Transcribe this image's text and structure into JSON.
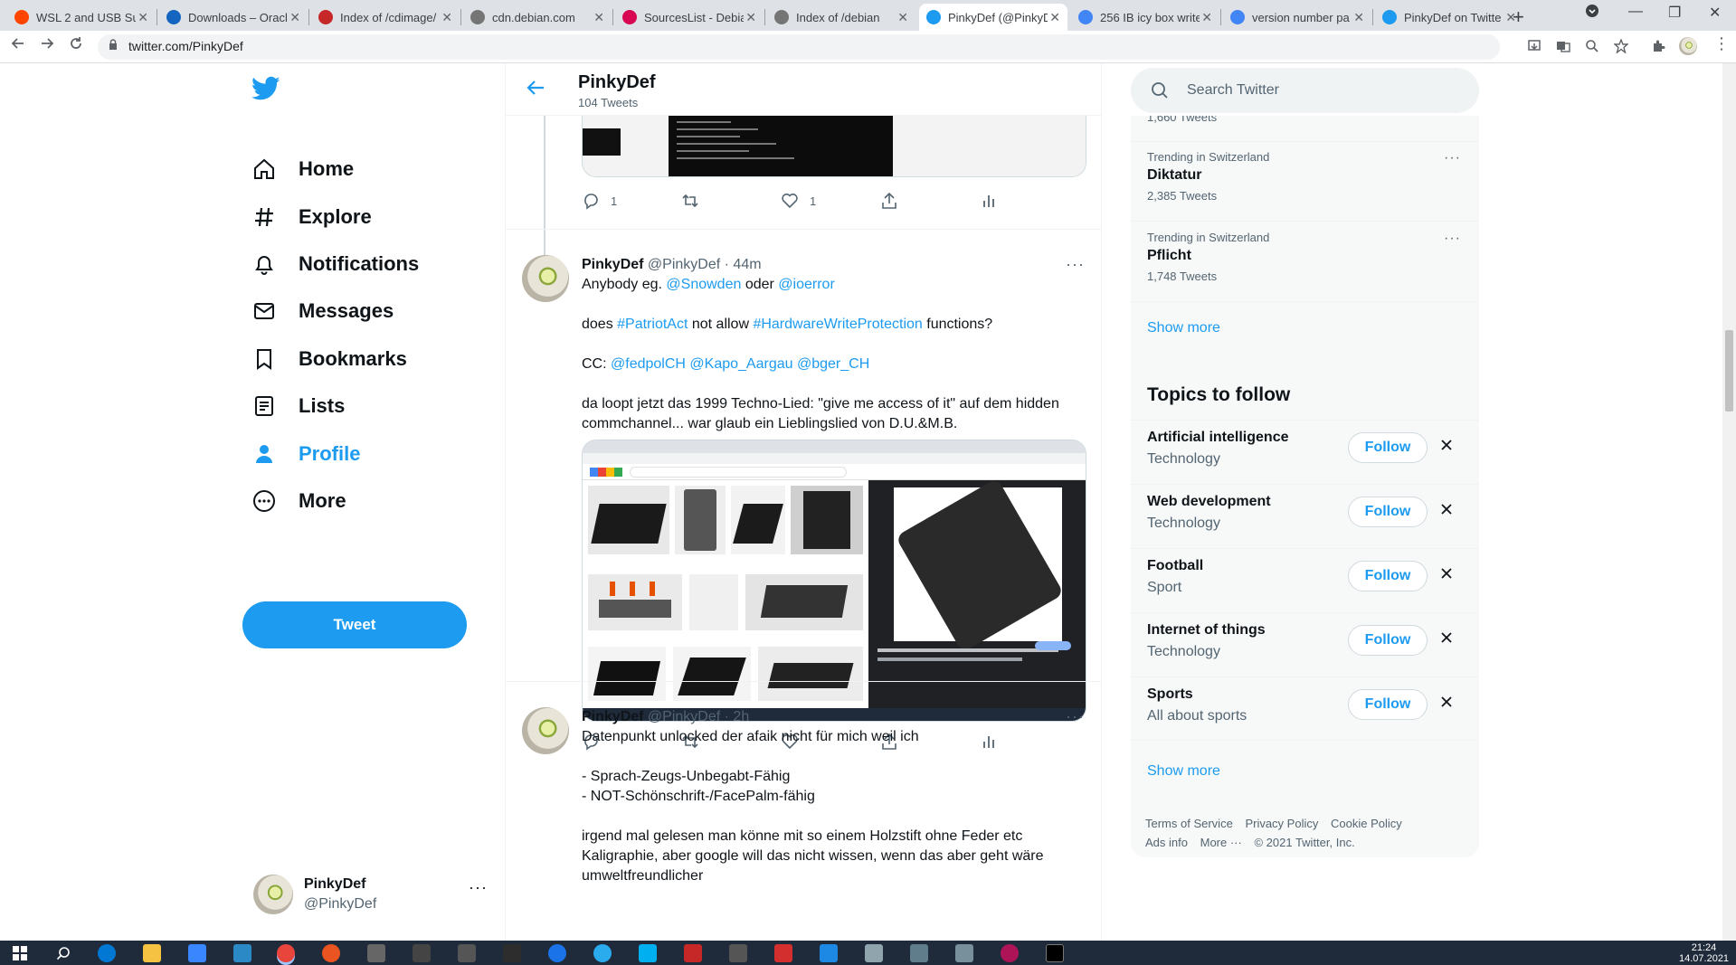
{
  "browser": {
    "tabs": [
      {
        "title": "WSL 2 and USB Sup",
        "fav_color": "#ff4500",
        "active": false
      },
      {
        "title": "Downloads – Oracl",
        "fav_color": "#1565c0",
        "active": false
      },
      {
        "title": "Index of /cdimage/",
        "fav_color": "#c62828",
        "active": false
      },
      {
        "title": "cdn.debian.com",
        "fav_color": "#757575",
        "active": false
      },
      {
        "title": "SourcesList - Debia",
        "fav_color": "#d70751",
        "active": false
      },
      {
        "title": "Index of /debian",
        "fav_color": "#757575",
        "active": false
      },
      {
        "title": "PinkyDef (@PinkyD",
        "fav_color": "#1d9bf0",
        "active": true
      },
      {
        "title": "256 IB icy box write",
        "fav_color": "#4285f4",
        "active": false
      },
      {
        "title": "version number pa",
        "fav_color": "#4285f4",
        "active": false
      },
      {
        "title": "PinkyDef on Twitte",
        "fav_color": "#1d9bf0",
        "active": false
      }
    ],
    "url": "twitter.com/PinkyDef"
  },
  "nav": {
    "items": [
      {
        "label": "Home",
        "icon": "home-icon"
      },
      {
        "label": "Explore",
        "icon": "hashtag-icon"
      },
      {
        "label": "Notifications",
        "icon": "bell-icon"
      },
      {
        "label": "Messages",
        "icon": "envelope-icon"
      },
      {
        "label": "Bookmarks",
        "icon": "bookmark-icon"
      },
      {
        "label": "Lists",
        "icon": "list-icon"
      },
      {
        "label": "Profile",
        "icon": "person-icon"
      },
      {
        "label": "More",
        "icon": "more-circle-icon"
      }
    ],
    "tweet_button": "Tweet",
    "account": {
      "name": "PinkyDef",
      "handle": "@PinkyDef"
    }
  },
  "header": {
    "title": "PinkyDef",
    "subtitle": "104 Tweets"
  },
  "prev_tweet": {
    "replies": "1",
    "likes": "1"
  },
  "tweets": [
    {
      "name": "PinkyDef",
      "handle": "@PinkyDef",
      "time": "· 44m",
      "line1_pre": "Anybody eg. ",
      "line1_m1": "@Snowden",
      "line1_mid": " oder ",
      "line1_m2": "@ioerror",
      "p2_pre": "does ",
      "p2_tag1": "#PatriotAct",
      "p2_mid": " not allow ",
      "p2_tag2": "#HardwareWriteProtection",
      "p2_post": " functions?",
      "p3_pre": "CC: ",
      "p3_m1": "@fedpolCH",
      "p3_m2": "@Kapo_Aargau",
      "p3_m3": "@bger_CH",
      "p4": "da loopt jetzt das 1999 Techno-Lied: \"give me access of it\" auf dem hidden commchannel... war glaub ein Lieblingslied von D.U.&M.B."
    },
    {
      "name": "PinkyDef",
      "handle": "@PinkyDef",
      "time": "· 2h",
      "line1": "Datenpunkt unlocked der afaik nicht für mich weil ich",
      "bullet1": "- Sprach-Zeugs-Unbegabt-Fähig",
      "bullet2": "- NOT-Schönschrift-/FacePalm-fähig",
      "p3": "irgend mal gelesen man könne mit so einem Holzstift ohne Feder etc Kaligraphie, aber google will das nicht wissen, wenn das aber geht wäre umweltfreundlicher"
    }
  ],
  "search": {
    "placeholder": "Search Twitter"
  },
  "trends": {
    "partial_count": "1,660 Tweets",
    "items": [
      {
        "context": "Trending in Switzerland",
        "title": "Diktatur",
        "count": "2,385 Tweets"
      },
      {
        "context": "Trending in Switzerland",
        "title": "Pflicht",
        "count": "1,748 Tweets"
      }
    ],
    "show_more": "Show more"
  },
  "topics": {
    "title": "Topics to follow",
    "items": [
      {
        "title": "Artificial intelligence",
        "category": "Technology"
      },
      {
        "title": "Web development",
        "category": "Technology"
      },
      {
        "title": "Football",
        "category": "Sport"
      },
      {
        "title": "Internet of things",
        "category": "Technology"
      },
      {
        "title": "Sports",
        "category": "All about sports"
      }
    ],
    "follow_label": "Follow",
    "show_more": "Show more"
  },
  "footer": {
    "terms": "Terms of Service",
    "privacy": "Privacy Policy",
    "cookie": "Cookie Policy",
    "ads": "Ads info",
    "more": "More ···",
    "copyright": "© 2021 Twitter, Inc."
  },
  "taskbar": {
    "time": "21:24",
    "date": "14.07.2021"
  },
  "colors": {
    "accent": "#1d9bf0",
    "text": "#0f1419",
    "muted": "#536471"
  }
}
